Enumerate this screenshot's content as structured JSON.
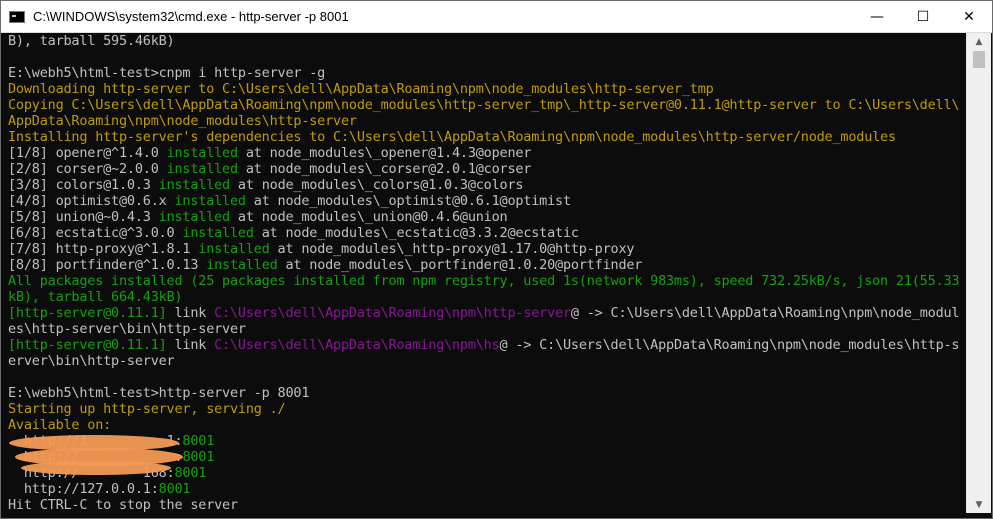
{
  "window": {
    "title": "C:\\WINDOWS\\system32\\cmd.exe - http-server  -p 8001",
    "minimize_glyph": "—",
    "maximize_glyph": "☐",
    "close_glyph": "✕",
    "app_icon": "cmd-console-icon"
  },
  "console": {
    "lines": [
      {
        "segments": [
          {
            "text": "B), tarball 595.46kB)",
            "color": "white"
          }
        ]
      },
      {
        "segments": [
          {
            "text": "",
            "color": "white"
          }
        ]
      },
      {
        "segments": [
          {
            "text": "E:\\webh5\\html-test>cnpm i http-server -g",
            "color": "white"
          }
        ]
      },
      {
        "segments": [
          {
            "text": "Downloading http-server to C:\\Users\\dell\\AppData\\Roaming\\npm\\node_modules\\http-server_tmp",
            "color": "yellow"
          }
        ]
      },
      {
        "segments": [
          {
            "text": "Copying C:\\Users\\dell\\AppData\\Roaming\\npm\\node_modules\\http-server_tmp\\_http-server@0.11.1@http-server to C:\\Users\\dell\\",
            "color": "yellow"
          }
        ]
      },
      {
        "segments": [
          {
            "text": "AppData\\Roaming\\npm\\node_modules\\http-server",
            "color": "yellow"
          }
        ]
      },
      {
        "segments": [
          {
            "text": "Installing http-server's dependencies to C:\\Users\\dell\\AppData\\Roaming\\npm\\node_modules\\http-server/node_modules",
            "color": "yellow"
          }
        ]
      },
      {
        "segments": [
          {
            "text": "[1/8] opener@^1.4.0 ",
            "color": "white"
          },
          {
            "text": "installed",
            "color": "green"
          },
          {
            "text": " at node_modules\\_opener@1.4.3@opener",
            "color": "white"
          }
        ]
      },
      {
        "segments": [
          {
            "text": "[2/8] corser@~2.0.0 ",
            "color": "white"
          },
          {
            "text": "installed",
            "color": "green"
          },
          {
            "text": " at node_modules\\_corser@2.0.1@corser",
            "color": "white"
          }
        ]
      },
      {
        "segments": [
          {
            "text": "[3/8] colors@1.0.3 ",
            "color": "white"
          },
          {
            "text": "installed",
            "color": "green"
          },
          {
            "text": " at node_modules\\_colors@1.0.3@colors",
            "color": "white"
          }
        ]
      },
      {
        "segments": [
          {
            "text": "[4/8] optimist@0.6.x ",
            "color": "white"
          },
          {
            "text": "installed",
            "color": "green"
          },
          {
            "text": " at node_modules\\_optimist@0.6.1@optimist",
            "color": "white"
          }
        ]
      },
      {
        "segments": [
          {
            "text": "[5/8] union@~0.4.3 ",
            "color": "white"
          },
          {
            "text": "installed",
            "color": "green"
          },
          {
            "text": " at node_modules\\_union@0.4.6@union",
            "color": "white"
          }
        ]
      },
      {
        "segments": [
          {
            "text": "[6/8] ecstatic@^3.0.0 ",
            "color": "white"
          },
          {
            "text": "installed",
            "color": "green"
          },
          {
            "text": " at node_modules\\_ecstatic@3.3.2@ecstatic",
            "color": "white"
          }
        ]
      },
      {
        "segments": [
          {
            "text": "[7/8] http-proxy@^1.8.1 ",
            "color": "white"
          },
          {
            "text": "installed",
            "color": "green"
          },
          {
            "text": " at node_modules\\_http-proxy@1.17.0@http-proxy",
            "color": "white"
          }
        ]
      },
      {
        "segments": [
          {
            "text": "[8/8] portfinder@^1.0.13 ",
            "color": "white"
          },
          {
            "text": "installed",
            "color": "green"
          },
          {
            "text": " at node_modules\\_portfinder@1.0.20@portfinder",
            "color": "white"
          }
        ]
      },
      {
        "segments": [
          {
            "text": "All packages installed (25 packages installed from npm registry, used 1s(network 983ms), speed 732.25kB/s, json 21(55.33",
            "color": "green"
          }
        ]
      },
      {
        "segments": [
          {
            "text": "kB), tarball 664.43kB)",
            "color": "green"
          }
        ]
      },
      {
        "segments": [
          {
            "text": "[http-server@0.11.1]",
            "color": "green"
          },
          {
            "text": " link ",
            "color": "white"
          },
          {
            "text": "C:\\Users\\dell\\AppData\\Roaming\\npm\\http-server",
            "color": "magenta"
          },
          {
            "text": "@ -> C:\\Users\\dell\\AppData\\Roaming\\npm\\node_modul",
            "color": "white"
          }
        ]
      },
      {
        "segments": [
          {
            "text": "es\\http-server\\bin\\http-server",
            "color": "white"
          }
        ]
      },
      {
        "segments": [
          {
            "text": "[http-server@0.11.1]",
            "color": "green"
          },
          {
            "text": " link ",
            "color": "white"
          },
          {
            "text": "C:\\Users\\dell\\AppData\\Roaming\\npm\\hs",
            "color": "magenta"
          },
          {
            "text": "@ -> C:\\Users\\dell\\AppData\\Roaming\\npm\\node_modules\\http-s",
            "color": "white"
          }
        ]
      },
      {
        "segments": [
          {
            "text": "erver\\bin\\http-server",
            "color": "white"
          }
        ]
      },
      {
        "segments": [
          {
            "text": "",
            "color": "white"
          }
        ]
      },
      {
        "segments": [
          {
            "text": "E:\\webh5\\html-test>http-server -p 8001",
            "color": "white"
          }
        ]
      },
      {
        "segments": [
          {
            "text": "Starting up http-server, serving ./",
            "color": "yellow"
          }
        ]
      },
      {
        "segments": [
          {
            "text": "Available on:",
            "color": "yellow"
          }
        ]
      },
      {
        "segments": [
          {
            "text": "  http://1",
            "color": "white"
          },
          {
            "text": "          ",
            "color": "white"
          },
          {
            "text": "1:",
            "color": "white"
          },
          {
            "text": "8001",
            "color": "green"
          }
        ]
      },
      {
        "segments": [
          {
            "text": "  http://",
            "color": "white"
          },
          {
            "text": "            ",
            "color": "white"
          },
          {
            "text": ":",
            "color": "white"
          },
          {
            "text": "8001",
            "color": "green"
          }
        ]
      },
      {
        "segments": [
          {
            "text": "  http://",
            "color": "white"
          },
          {
            "text": "        ",
            "color": "white"
          },
          {
            "text": "168:",
            "color": "white"
          },
          {
            "text": "8001",
            "color": "green"
          }
        ]
      },
      {
        "segments": [
          {
            "text": "  http://127.0.0.1:",
            "color": "white"
          },
          {
            "text": "8001",
            "color": "green"
          }
        ]
      },
      {
        "segments": [
          {
            "text": "Hit CTRL-C to stop the server",
            "color": "white"
          }
        ]
      }
    ]
  },
  "scrollbar": {
    "up_glyph": "▲",
    "down_glyph": "▼"
  }
}
